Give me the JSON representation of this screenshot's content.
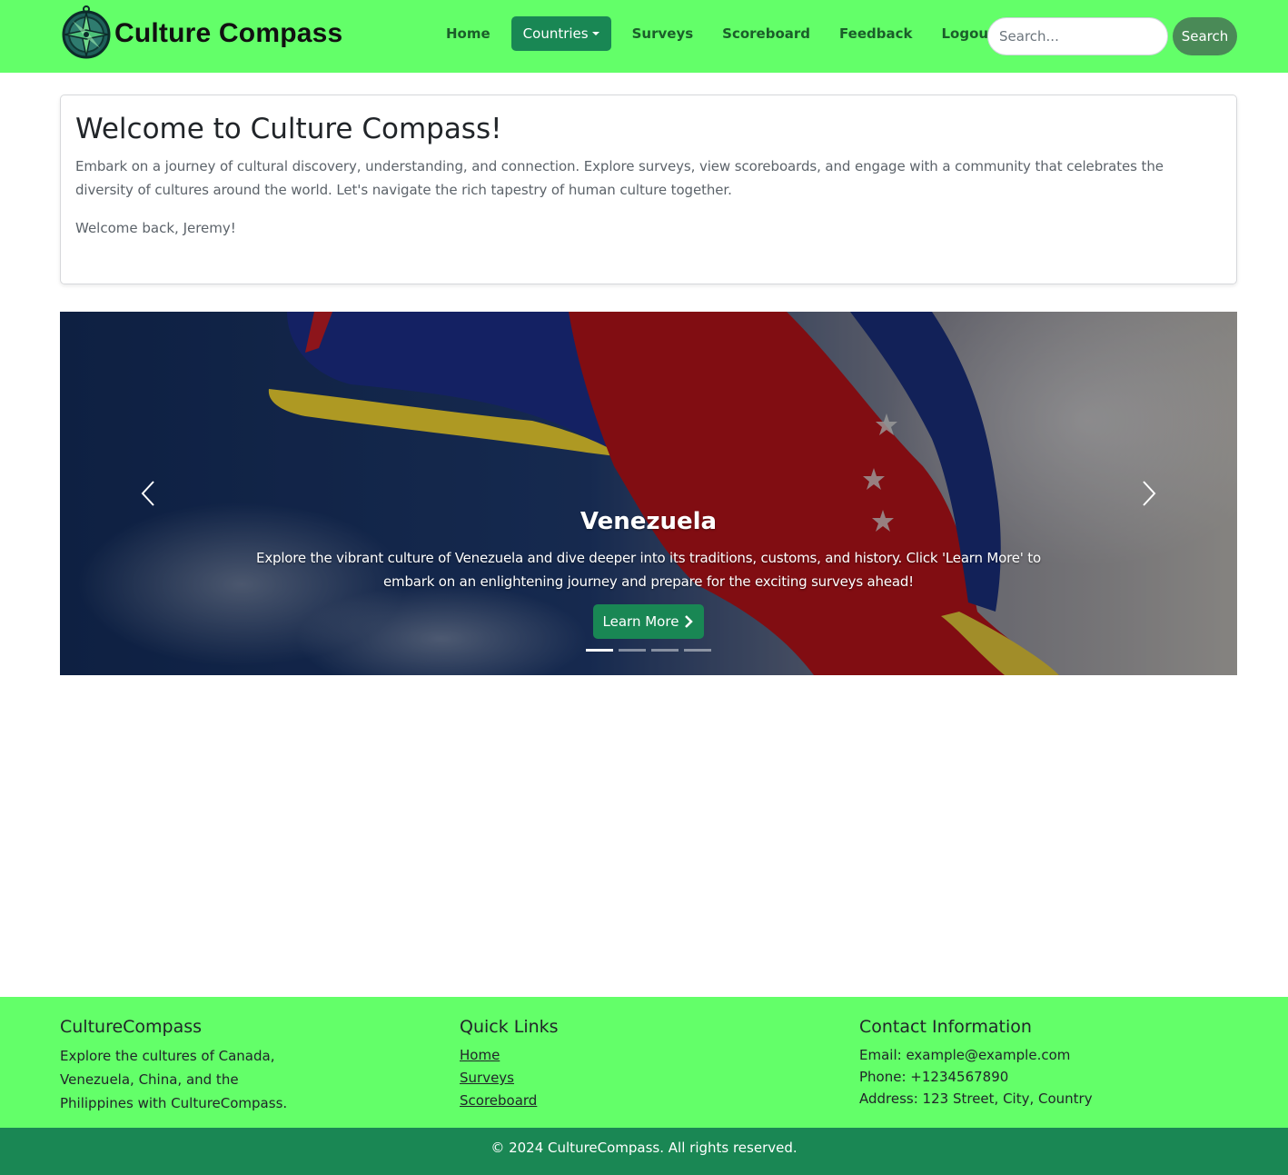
{
  "brand": {
    "name": "Culture Compass",
    "logo_icon": "compass-icon"
  },
  "nav": {
    "items": [
      {
        "label": "Home"
      },
      {
        "label": "Countries",
        "dropdown": true,
        "active": true
      },
      {
        "label": "Surveys"
      },
      {
        "label": "Scoreboard"
      },
      {
        "label": "Feedback"
      },
      {
        "label": "Logout"
      }
    ]
  },
  "search": {
    "placeholder": "Search...",
    "value": "",
    "button_label": "Search"
  },
  "welcome": {
    "title": "Welcome to Culture Compass!",
    "lead": "Embark on a journey of cultural discovery, understanding, and connection. Explore surveys, view scoreboards, and engage with a community that celebrates the diversity of cultures around the world. Let's navigate the rich tapestry of human culture together.",
    "greeting": "Welcome back, Jeremy!"
  },
  "carousel": {
    "slide_title": "Venezuela",
    "slide_text": "Explore the vibrant culture of Venezuela and dive deeper into its traditions, customs, and history. Click 'Learn More' to embark on an enlightening journey and prepare for the exciting surveys ahead!",
    "button_label": "Learn More",
    "slide_count": 4,
    "active_slide": 1,
    "prev_icon": "chevron-left-icon",
    "next_icon": "chevron-right-icon"
  },
  "footer": {
    "about": {
      "title": "CultureCompass",
      "text": "Explore the cultures of Canada, Venezuela, China, and the Philippines with CultureCompass."
    },
    "quick_links": {
      "title": "Quick Links",
      "links": [
        "Home",
        "Surveys",
        "Scoreboard"
      ]
    },
    "contact": {
      "title": "Contact Information",
      "email": "Email: example@example.com",
      "phone": "Phone: +1234567890",
      "address": "Address: 123 Street, City, Country"
    },
    "copyright": "© 2024 CultureCompass. All rights reserved."
  },
  "colors": {
    "nav_bg": "#63ff69",
    "accent": "#198754",
    "search_button": "#4a8a57",
    "copyright_bg": "#1a8754"
  }
}
